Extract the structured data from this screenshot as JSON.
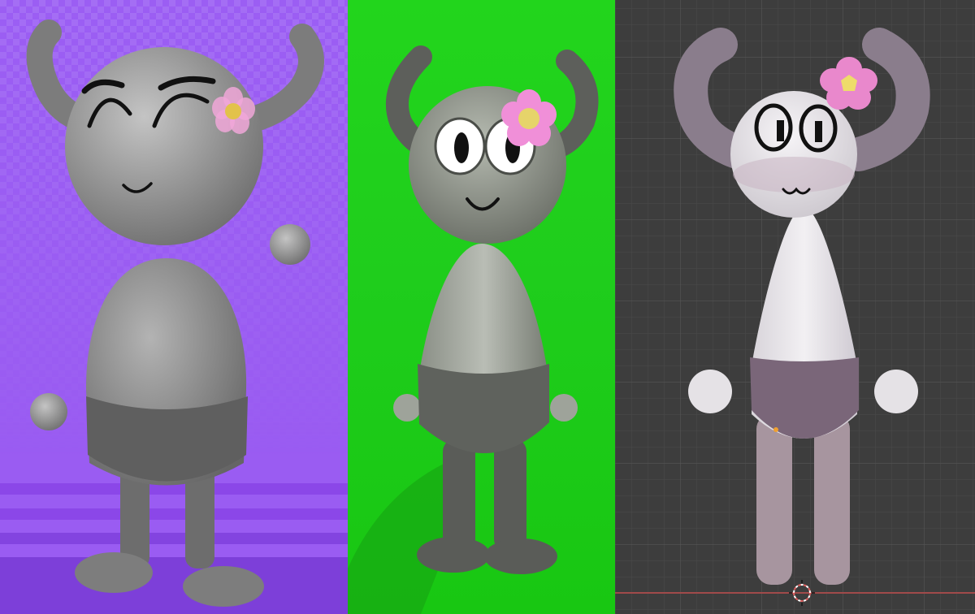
{
  "colors": {
    "purple_bg": "#9a5cf2",
    "green_bg": "#1ed31a",
    "grid_bg": "#3d3d3d",
    "flower_pink": "#f08fd8",
    "flower_yellow": "#e6d46a",
    "body_gray": "#8c8c8c",
    "pants_gray": "#5f5f5f",
    "pale_body": "#e9e6ea",
    "mauve_pants": "#7a6679"
  },
  "panels": [
    {
      "name": "purple-background-render",
      "character": "gray-horned-creature-closed-eyes"
    },
    {
      "name": "green-screen-render",
      "character": "gray-horned-creature-open-eyes"
    },
    {
      "name": "blender-viewport",
      "character": "pale-horned-creature-model"
    }
  ]
}
